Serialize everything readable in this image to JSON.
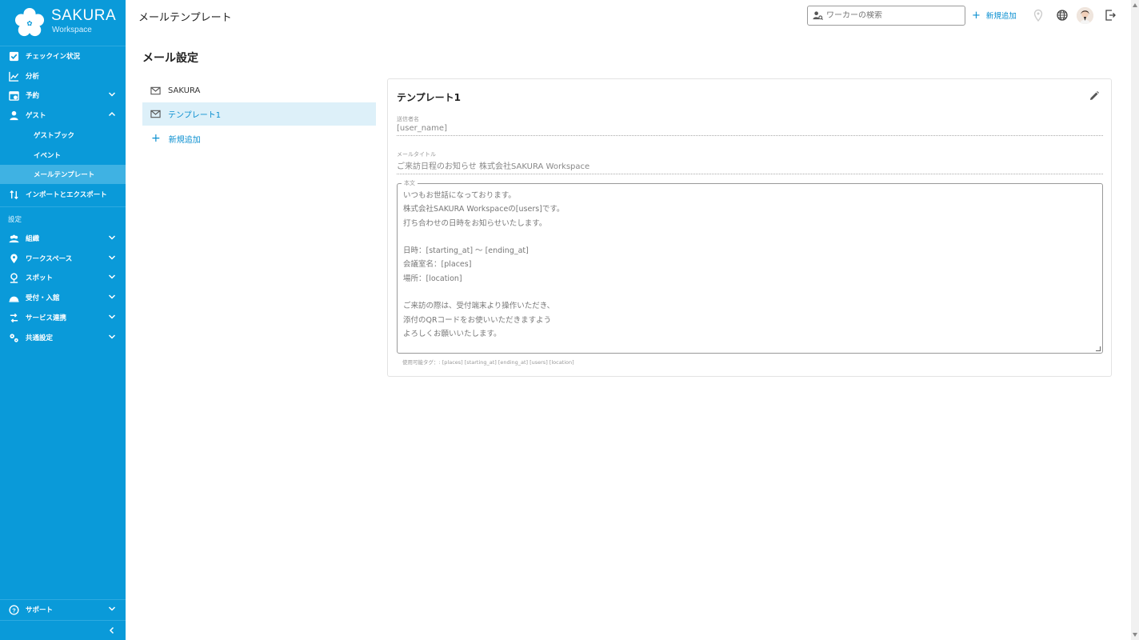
{
  "brand": {
    "name": "SAKURA",
    "sub": "Workspace"
  },
  "sidebar": {
    "items": [
      {
        "label": "チェックイン状況",
        "icon": "checkbox-icon"
      },
      {
        "label": "分析",
        "icon": "chart-icon"
      },
      {
        "label": "予約",
        "icon": "calendar-icon"
      },
      {
        "label": "ゲスト",
        "icon": "person-icon"
      },
      {
        "label": "ゲストブック"
      },
      {
        "label": "イベント"
      },
      {
        "label": "メールテンプレート"
      },
      {
        "label": "インポートとエクスポート",
        "icon": "import-export-icon"
      }
    ],
    "settings_label": "設定",
    "settings_items": [
      {
        "label": "組織",
        "icon": "group-icon"
      },
      {
        "label": "ワークスペース",
        "icon": "location-pin-icon"
      },
      {
        "label": "スポット",
        "icon": "spot-icon"
      },
      {
        "label": "受付・入館",
        "icon": "reception-icon"
      },
      {
        "label": "サービス連携",
        "icon": "service-link-icon"
      },
      {
        "label": "共通設定",
        "icon": "settings-icon"
      }
    ],
    "support": "サポート",
    "collapse_icon": "chevron-left-icon"
  },
  "header": {
    "title": "メールテンプレート",
    "search_placeholder": "ワーカーの検索",
    "add_label": "新規追加"
  },
  "main": {
    "section_title": "メール設定",
    "templates": [
      {
        "label": "SAKURA",
        "active": false
      },
      {
        "label": "テンプレート1",
        "active": true
      }
    ],
    "add_label": "新規追加"
  },
  "card": {
    "title": "テンプレート1",
    "sender_label": "送信者名",
    "sender_value": "[user_name]",
    "subject_label": "メールタイトル",
    "subject_value": "ご来訪日程のお知らせ 株式会社SAKURA Workspace",
    "body_label": "本文",
    "body_value": "いつもお世話になっております。\n株式会社SAKURA Workspaceの[users]です。\n打ち合わせの日時をお知らせいたします。\n\n日時：[starting_at] 〜 [ending_at]\n会議室名：[places]\n場所：[location]\n\nご来訪の際は、受付端末より操作いただき、\n添付のQRコードをお使いいただきますよう\nよろしくお願いいたします。",
    "tags_hint": "使用可能タグ：: [places] [starting_at] [ending_at] [users] [location]"
  },
  "colors": {
    "sidebar": "#0a9ad9",
    "accent": "#0a8fd0",
    "active_row": "#ddf0f9"
  }
}
